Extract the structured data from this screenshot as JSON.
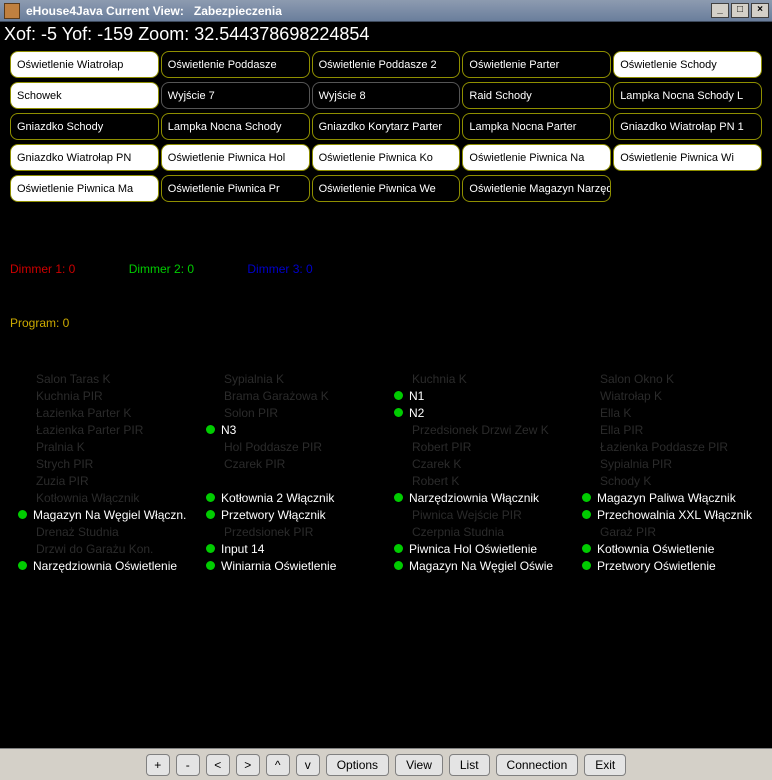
{
  "window": {
    "app": "eHouse4Java Current View:",
    "view": "Zabezpieczenia"
  },
  "coords": {
    "xof_label": "Xof:",
    "xof": "-5",
    "yof_label": "Yof:",
    "yof": "-159",
    "zoom_label": "Zoom:",
    "zoom": "32.544378698224854"
  },
  "devices": [
    {
      "label": "Oświetlenie Wiatrołap",
      "state": "bwhite"
    },
    {
      "label": "Oświetlenie Poddasze",
      "state": "byellow"
    },
    {
      "label": "Oświetlenie Poddasze 2",
      "state": "byellow"
    },
    {
      "label": "Oświetlenie Parter",
      "state": "byellow"
    },
    {
      "label": "Oświetlenie Schody",
      "state": "bwhite"
    },
    {
      "label": "Schowek",
      "state": "bwhite"
    },
    {
      "label": "Wyjście 7",
      "state": "bgray"
    },
    {
      "label": "Wyjście 8",
      "state": "bgray"
    },
    {
      "label": "Raid Schody",
      "state": "byellow"
    },
    {
      "label": "Lampka Nocna Schody L",
      "state": "byellow"
    },
    {
      "label": "Gniazdko Schody",
      "state": "byellow"
    },
    {
      "label": "Lampka Nocna Schody",
      "state": "byellow"
    },
    {
      "label": "Gniazdko Korytarz Parter",
      "state": "byellow"
    },
    {
      "label": "Lampka Nocna Parter",
      "state": "byellow"
    },
    {
      "label": "Gniazdko Wiatrołap PN 1",
      "state": "byellow"
    },
    {
      "label": "Gniazdko Wiatrołap PN",
      "state": "bwhite"
    },
    {
      "label": "Oświetlenie Piwnica Hol",
      "state": "bwhite"
    },
    {
      "label": "Oświetlenie Piwnica Ko",
      "state": "bwhite"
    },
    {
      "label": "Oświetlenie Piwnica Na",
      "state": "bwhite"
    },
    {
      "label": "Oświetlenie Piwnica Wi",
      "state": "bwhite"
    },
    {
      "label": "Oświetlenie Piwnica Ma",
      "state": "bwhite"
    },
    {
      "label": "Oświetlenie Piwnica Pr",
      "state": "byellow"
    },
    {
      "label": "Oświetlenie Piwnica We",
      "state": "byellow"
    },
    {
      "label": "Oświetlenie Magazyn Narzędzia",
      "state": "byellow"
    }
  ],
  "dimmers": [
    {
      "label": "Dimmer 1: 0",
      "cls": "d-red"
    },
    {
      "label": "Dimmer 2: 0",
      "cls": "d-green"
    },
    {
      "label": "Dimmer 3: 0",
      "cls": "d-blue"
    }
  ],
  "program": "Program: 0",
  "sensors": {
    "cols": [
      [
        {
          "t": "Salon Taras K",
          "on": false,
          "dot": false,
          "indent": true
        },
        {
          "t": "Kuchnia PIR",
          "on": false,
          "dot": false,
          "indent": true
        },
        {
          "t": "Łazienka Parter K",
          "on": false,
          "dot": false,
          "indent": true
        },
        {
          "t": "Łazienka Parter PIR",
          "on": false,
          "dot": false,
          "indent": true
        },
        {
          "t": "Pralnia K",
          "on": false,
          "dot": false,
          "indent": true
        },
        {
          "t": "Strych PIR",
          "on": false,
          "dot": false,
          "indent": true
        },
        {
          "t": "Zuzia PIR",
          "on": false,
          "dot": false,
          "indent": true
        },
        {
          "t": "Kotłownia Włącznik",
          "on": false,
          "dot": false,
          "indent": true
        },
        {
          "t": "Magazyn Na Węgiel Włączn.",
          "on": true,
          "dot": true
        },
        {
          "t": "Drenaż Studnia",
          "on": false,
          "dot": false,
          "indent": true
        },
        {
          "t": "Drzwi do Garażu Kon.",
          "on": false,
          "dot": false,
          "indent": true
        },
        {
          "t": "Narzędziownia Oświetlenie",
          "on": true,
          "dot": true
        }
      ],
      [
        {
          "t": "Sypialnia K",
          "on": false,
          "dot": false,
          "indent": true
        },
        {
          "t": "Brama Garażowa K",
          "on": false,
          "dot": false,
          "indent": true
        },
        {
          "t": "Solon PIR",
          "on": false,
          "dot": false,
          "indent": true
        },
        {
          "t": "N3",
          "on": true,
          "dot": true
        },
        {
          "t": "Hol Poddasze PIR",
          "on": false,
          "dot": false,
          "indent": true
        },
        {
          "t": "Czarek PIR",
          "on": false,
          "dot": false,
          "indent": true
        },
        {
          "t": "",
          "on": false,
          "dot": false,
          "indent": true
        },
        {
          "t": "Kotłownia 2 Włącznik",
          "on": true,
          "dot": true
        },
        {
          "t": "Przetwory Włącznik",
          "on": true,
          "dot": true
        },
        {
          "t": "Przedsionek PIR",
          "on": false,
          "dot": false,
          "indent": true
        },
        {
          "t": "Input 14",
          "on": true,
          "dot": true
        },
        {
          "t": "Winiarnia Oświetlenie",
          "on": true,
          "dot": true
        }
      ],
      [
        {
          "t": "Kuchnia K",
          "on": false,
          "dot": false,
          "indent": true
        },
        {
          "t": "N1",
          "on": true,
          "dot": true
        },
        {
          "t": "N2",
          "on": true,
          "dot": true
        },
        {
          "t": "Przedsionek Drzwi Zew K",
          "on": false,
          "dot": false,
          "indent": true
        },
        {
          "t": "Robert PIR",
          "on": false,
          "dot": false,
          "indent": true
        },
        {
          "t": "Czarek K",
          "on": false,
          "dot": false,
          "indent": true
        },
        {
          "t": "Robert K",
          "on": false,
          "dot": false,
          "indent": true
        },
        {
          "t": "Narzędziownia Włącznik",
          "on": true,
          "dot": true
        },
        {
          "t": "Piwnica Wejście PIR",
          "on": false,
          "dot": false,
          "indent": true
        },
        {
          "t": "Czerpnia Studnia",
          "on": false,
          "dot": false,
          "indent": true
        },
        {
          "t": "Piwnica Hol Oświetlenie",
          "on": true,
          "dot": true
        },
        {
          "t": "Magazyn Na Węgiel Oświe",
          "on": true,
          "dot": true
        }
      ],
      [
        {
          "t": "Salon Okno K",
          "on": false,
          "dot": false,
          "indent": true
        },
        {
          "t": "Wiatrołap K",
          "on": false,
          "dot": false,
          "indent": true
        },
        {
          "t": "Ella K",
          "on": false,
          "dot": false,
          "indent": true
        },
        {
          "t": "Ella PIR",
          "on": false,
          "dot": false,
          "indent": true
        },
        {
          "t": "Łazienka Poddasze PIR",
          "on": false,
          "dot": false,
          "indent": true
        },
        {
          "t": "Sypialnia PIR",
          "on": false,
          "dot": false,
          "indent": true
        },
        {
          "t": "Schody K",
          "on": false,
          "dot": false,
          "indent": true
        },
        {
          "t": "Magazyn Paliwa Włącznik",
          "on": true,
          "dot": true
        },
        {
          "t": "Przechowalnia XXL Włącznik",
          "on": true,
          "dot": true
        },
        {
          "t": "Garaż PIR",
          "on": false,
          "dot": false,
          "indent": true
        },
        {
          "t": "Kotłownia Oświetlenie",
          "on": true,
          "dot": true
        },
        {
          "t": "Przetwory Oświetlenie",
          "on": true,
          "dot": true
        }
      ]
    ]
  },
  "toolbar": {
    "plus": "+",
    "minus": "-",
    "left": "<",
    "right": ">",
    "up": "^",
    "down": "v",
    "options": "Options",
    "view": "View",
    "list": "List",
    "connection": "Connection",
    "exit": "Exit"
  },
  "winbtns": {
    "min": "_",
    "max": "□",
    "close": "×"
  }
}
